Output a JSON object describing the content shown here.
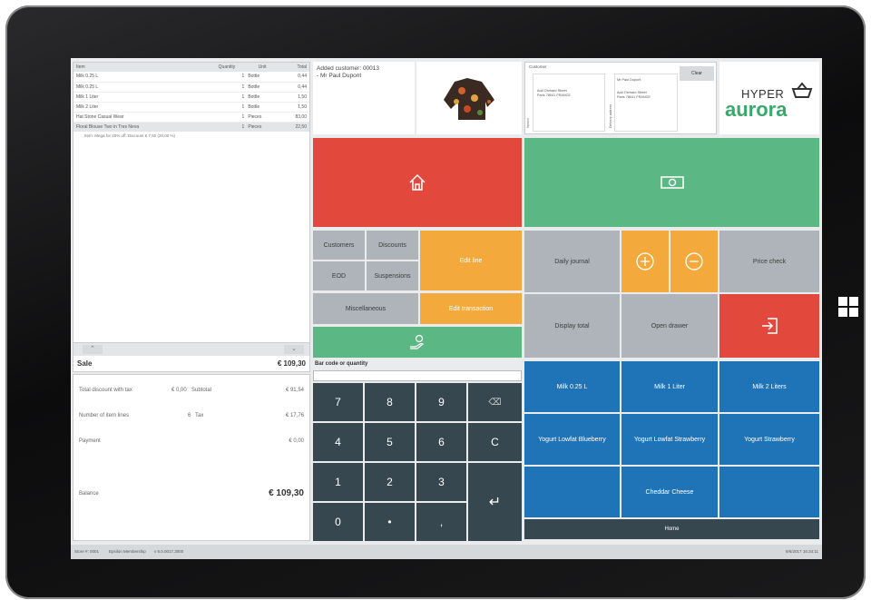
{
  "lines": {
    "headers": [
      "Item",
      "Quantity",
      "Unit",
      "Total"
    ],
    "rows": [
      [
        "Milk 0.25 L",
        "1",
        "Bottle",
        "0,44"
      ],
      [
        "Milk 0.25 L",
        "1",
        "Bottle",
        "0,44"
      ],
      [
        "Milk 1 Liter",
        "1",
        "Bottle",
        "1,50"
      ],
      [
        "Milk 2 Liter",
        "1",
        "Bottle",
        "1,50"
      ],
      [
        "Hat Stone Casual Wear",
        "1",
        "Pieces",
        "83,00"
      ],
      [
        "Floral Blouse Two in Tres Neva",
        "1",
        "Pieces",
        "22,50"
      ]
    ],
    "discount_note": "Item: Mega for 20% off. Discount € 7,50 (20,00 %)"
  },
  "sale": {
    "label": "Sale",
    "total": "€ 109,30"
  },
  "totals": {
    "discount_label": "Total discount with tax",
    "discount_value": "€ 0,00",
    "subtotal_label": "Subtotal",
    "subtotal_value": "€ 91,54",
    "lines_label": "Number of item lines",
    "lines_value": "6",
    "tax_label": "Tax",
    "tax_value": "€ 17,76",
    "payment_label": "Payment",
    "payment_value": "€ 0,00",
    "balance_label": "Balance",
    "balance_value": "€ 109,30"
  },
  "notification": "Added customer: 00013 - Mr Paul Dupont",
  "customer_panel": {
    "title": "Customer",
    "clear": "Clear",
    "name": "Mr Paul Dupont",
    "address": "Add Orchard Street Paris 78041 FRANCE",
    "shipping": "Add Orchard Street Paris 78041 FRANCE",
    "side1": "Invoice",
    "side2": "Delivery address"
  },
  "logo": {
    "top": "HYPER",
    "bottom": "aurora"
  },
  "buttons": {
    "customers": "Customers",
    "discounts": "Discounts",
    "eod": "EOD",
    "suspensions": "Suspensions",
    "miscellaneous": "Miscellaneous",
    "edit_line": "Edit line",
    "edit_transaction": "Edit transaction",
    "daily_journal": "Daily journal",
    "price_check": "Price check",
    "display_total": "Display total",
    "open_drawer": "Open drawer"
  },
  "barcode": {
    "label": "Bar code or quantity",
    "value": ""
  },
  "keypad": [
    "7",
    "8",
    "9",
    "⌫",
    "4",
    "5",
    "6",
    "C",
    "1",
    "2",
    "3",
    "↵",
    "0",
    "•",
    ","
  ],
  "products": [
    "Milk 0.25 L",
    "Milk 1 Liter",
    "Milk 2 Liters",
    "Yogurt Lowfat Blueberry",
    "Yogurt Lowfat Strawberry",
    "Yogurt Strawberry",
    "",
    "Cheddar Cheese",
    ""
  ],
  "home_label": "Home",
  "status": {
    "store": "Store #: 0001",
    "register": "Epsilon Membership",
    "version": "v 8.0.0017.3000",
    "datetime": "9/6/2017 16:34:11"
  },
  "colors": {
    "red": "#e2483c",
    "green": "#5bb784",
    "orange": "#f3a93b",
    "blue": "#1f73b7",
    "dark": "#37474f"
  }
}
